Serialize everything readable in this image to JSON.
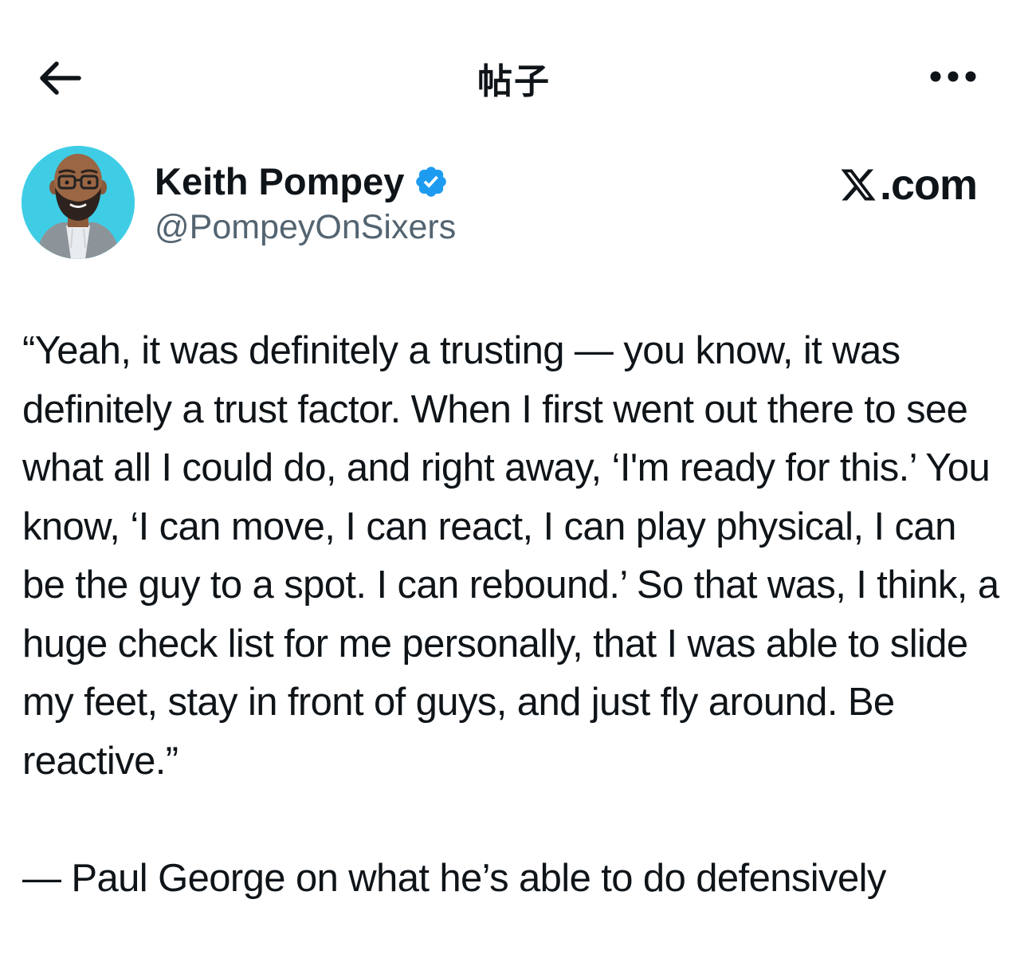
{
  "header": {
    "title": "帖子",
    "back_icon": "arrow-left-icon",
    "more_icon": "more-horizontal-icon"
  },
  "author": {
    "display_name": "Keith Pompey",
    "handle": "@PompeyOnSixers",
    "verified": true,
    "verified_color": "#1d9bf0",
    "avatar_bg": "#3fcde6"
  },
  "watermark": {
    "text": ".com",
    "icon": "x-logo-icon"
  },
  "post": {
    "text": "“Yeah, it was definitely a trusting — you know, it was definitely a trust factor. When I first went out there to see what all I could do, and right away, ‘I'm ready for this.’ You know, ‘I can move, I can react, I can play physical, I can be the guy to a spot. I can rebound.’ So that was, I think, a huge check list for me personally, that I was able to slide my feet, stay in front of guys, and just fly around. Be reactive.”\n\n— Paul George on what he’s able to do defensively"
  },
  "colors": {
    "text": "#0f1419",
    "secondary": "#536471",
    "background": "#ffffff"
  }
}
